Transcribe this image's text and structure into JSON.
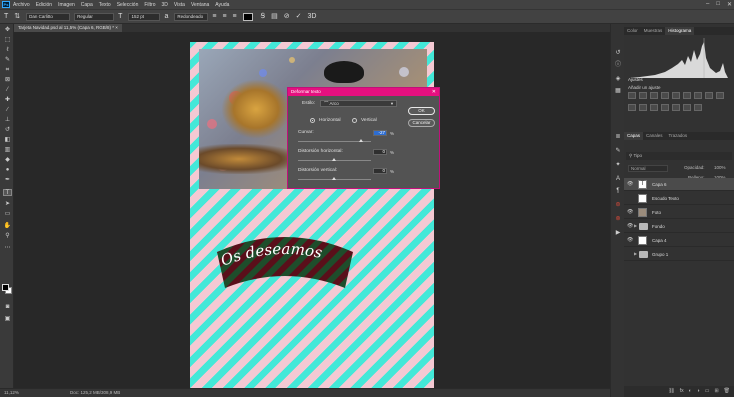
{
  "menu": {
    "items": [
      "Archivo",
      "Edición",
      "Imagen",
      "Capa",
      "Texto",
      "Selección",
      "Filtro",
      "3D",
      "Vista",
      "Ventana",
      "Ayuda"
    ],
    "logo": "Ps"
  },
  "window_controls": {
    "minimize": "–",
    "maximize": "□",
    "close": "✕"
  },
  "options_bar": {
    "font_family": "Dan Carlitto",
    "font_style": "Regular",
    "font_size": "152 pt",
    "antialias": "Redondeado",
    "text_color": "#000000"
  },
  "document": {
    "tab_title": "Tarjeta Navidad.psd al 11,5% (Capa 6, RGB/8) *",
    "tab_close": "×",
    "zoom": "11,12%",
    "doc_info": "Doc: 125,2 MB/308,9 MB",
    "canvas_text": "Os deseamos",
    "stripe_pink": "#f4c9d3",
    "stripe_cyan": "#43e8d8"
  },
  "warp_dialog": {
    "title": "Deformar texto",
    "close": "✕",
    "style_label": "Estilo:",
    "style_value": "Arco",
    "horizontal_label": "Horizontal",
    "vertical_label": "Vertical",
    "orientation_selected": "Horizontal",
    "bend_label": "Curvar:",
    "bend_value": "-27",
    "h_distortion_label": "Distorsión horizontal:",
    "h_distortion_value": "0",
    "v_distortion_label": "Distorsión vertical:",
    "v_distortion_value": "0",
    "percent": "%",
    "ok": "OK",
    "cancel": "Cancelar",
    "accent_color": "#e5107f"
  },
  "top_panel": {
    "tabs": [
      "Color",
      "Muestras",
      "Histograma"
    ],
    "active_tab": "Histograma"
  },
  "adjustments": {
    "title": "Ajustes",
    "subtitle": "Añadir un ajuste"
  },
  "layers_panel": {
    "tabs": [
      "Capas",
      "Canales",
      "Trazados"
    ],
    "active_tab": "Capas",
    "filter_label": "Tipo",
    "blend_mode": "Normal",
    "opacity_label": "Opacidad:",
    "opacity_value": "100%",
    "fill_label": "Relleno:",
    "fill_value": "100%",
    "layers": [
      {
        "name": "Capa 6",
        "kind": "text",
        "visible": true,
        "selected": true
      },
      {
        "name": "Escudo Texto",
        "kind": "pixel",
        "visible": false,
        "selected": false
      },
      {
        "name": "Foto",
        "kind": "photo",
        "visible": true,
        "selected": false
      },
      {
        "name": "Fondo",
        "kind": "group",
        "visible": true,
        "selected": false
      },
      {
        "name": "Capa 4",
        "kind": "pixel",
        "visible": true,
        "selected": false
      },
      {
        "name": "Grupo 1",
        "kind": "group",
        "visible": false,
        "selected": false
      }
    ]
  }
}
